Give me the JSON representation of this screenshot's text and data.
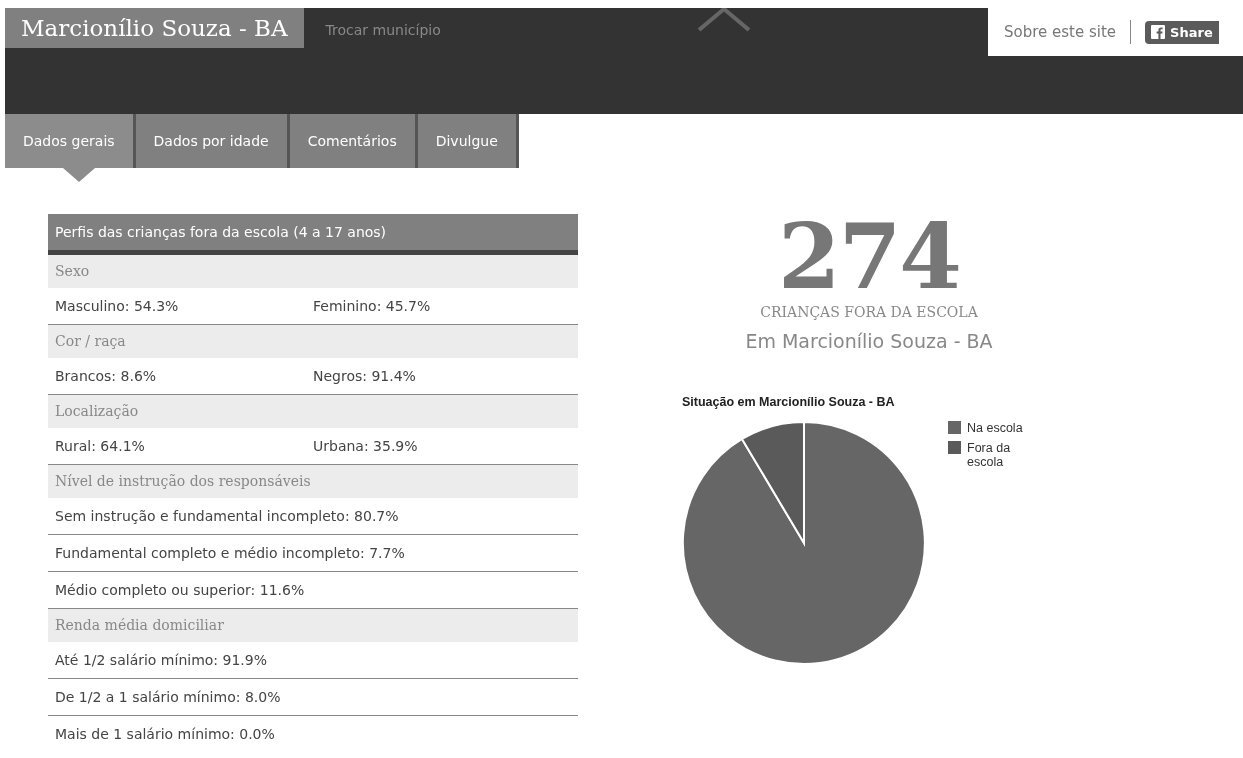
{
  "header": {
    "title": "Marcionílio Souza - BA",
    "change_link": "Trocar município",
    "about_link": "Sobre este site",
    "share_button": "Share"
  },
  "tabs": [
    {
      "label": "Dados gerais",
      "selected": true
    },
    {
      "label": "Dados por idade",
      "selected": false
    },
    {
      "label": "Comentários",
      "selected": false
    },
    {
      "label": "Divulgue",
      "selected": false
    }
  ],
  "profile_table": {
    "title": "Perfis das crianças fora da escola (4 a 17 anos)",
    "sections": [
      {
        "heading": "Sexo",
        "rows": [
          [
            "Masculino: 54.3%",
            "Feminino: 45.7%"
          ]
        ]
      },
      {
        "heading": "Cor / raça",
        "rows": [
          [
            "Brancos: 8.6%",
            "Negros: 91.4%"
          ]
        ]
      },
      {
        "heading": "Localização",
        "rows": [
          [
            "Rural: 64.1%",
            "Urbana: 35.9%"
          ]
        ]
      },
      {
        "heading": "Nível de instrução dos responsáveis",
        "rows": [
          [
            "Sem instrução e fundamental incompleto: 80.7%"
          ],
          [
            "Fundamental completo e médio incompleto: 7.7%"
          ],
          [
            "Médio completo ou superior: 11.6%"
          ]
        ]
      },
      {
        "heading": "Renda média domiciliar",
        "rows": [
          [
            "Até 1/2 salário mínimo: 91.9%"
          ],
          [
            "De 1/2 a 1 salário mínimo: 8.0%"
          ],
          [
            "Mais de 1 salário mínimo: 0.0%"
          ]
        ]
      }
    ]
  },
  "summary": {
    "count": "274",
    "count_label": "CRIANÇAS FORA DA ESCOLA",
    "place": "Em Marcionílio Souza - BA"
  },
  "pie": {
    "title": "Situação em Marcionílio Souza - BA",
    "legend": [
      {
        "label": "Na escola",
        "color": "#666666"
      },
      {
        "label": "Fora da escola",
        "color": "#5a5a5a"
      }
    ]
  }
}
